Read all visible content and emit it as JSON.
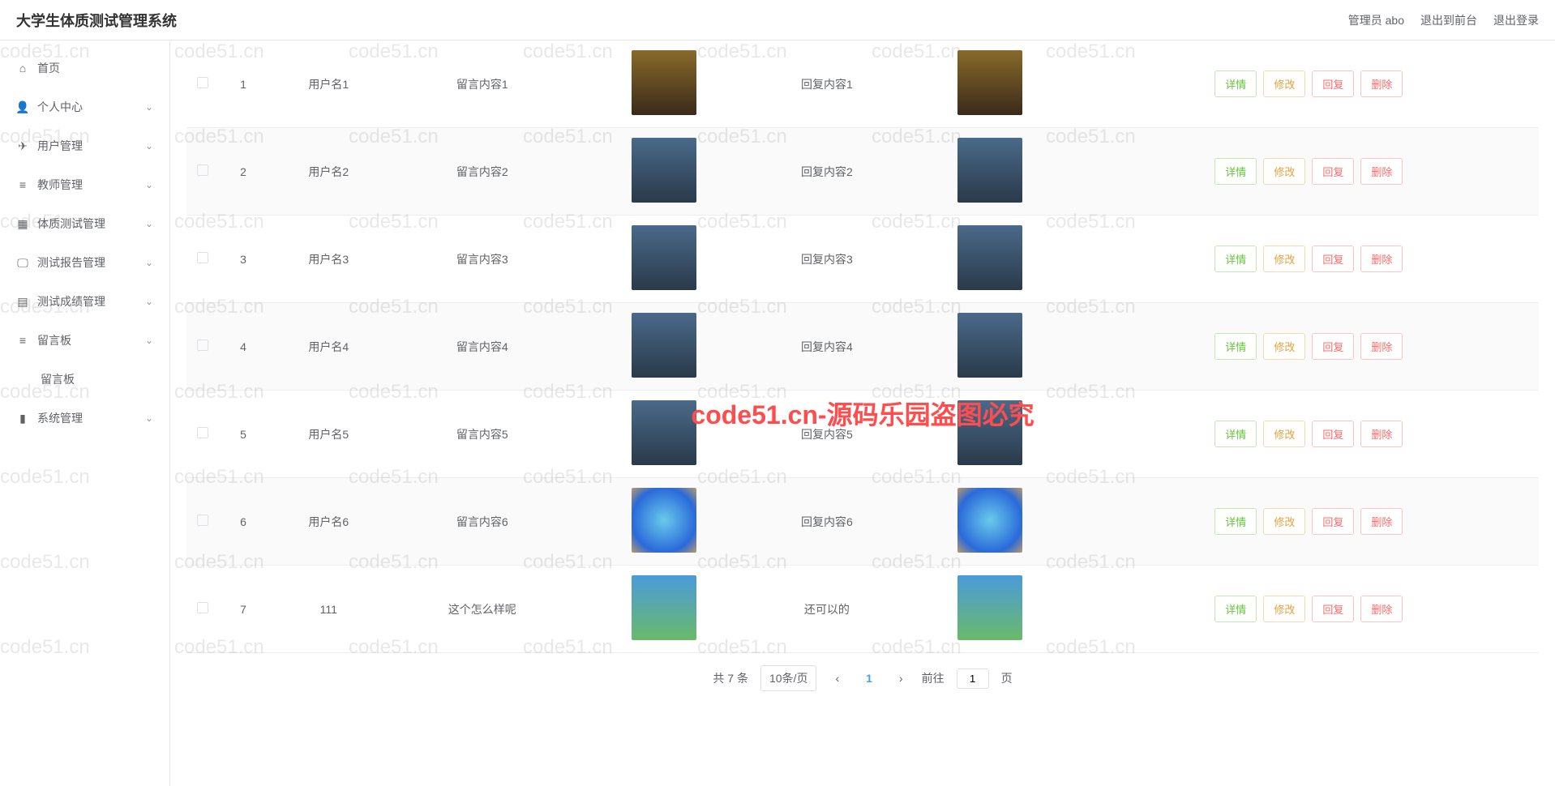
{
  "header": {
    "title": "大学生体质测试管理系统",
    "admin_label": "管理员 abo",
    "exit_front": "退出到前台",
    "logout": "退出登录"
  },
  "sidebar": {
    "items": [
      {
        "icon": "home",
        "label": "首页",
        "expandable": false
      },
      {
        "icon": "user",
        "label": "个人中心",
        "expandable": true
      },
      {
        "icon": "send",
        "label": "用户管理",
        "expandable": true
      },
      {
        "icon": "list",
        "label": "教师管理",
        "expandable": true
      },
      {
        "icon": "grid",
        "label": "体质测试管理",
        "expandable": true
      },
      {
        "icon": "monitor",
        "label": "测试报告管理",
        "expandable": true
      },
      {
        "icon": "file",
        "label": "测试成绩管理",
        "expandable": true
      },
      {
        "icon": "menu",
        "label": "留言板",
        "expandable": true
      },
      {
        "icon": "chart",
        "label": "系统管理",
        "expandable": true
      }
    ],
    "submenu_messageboard": "留言板"
  },
  "table": {
    "rows": [
      {
        "index": "1",
        "username": "用户名1",
        "message": "留言内容1",
        "reply": "回复内容1",
        "thumb": "sunset"
      },
      {
        "index": "2",
        "username": "用户名2",
        "message": "留言内容2",
        "reply": "回复内容2",
        "thumb": "night"
      },
      {
        "index": "3",
        "username": "用户名3",
        "message": "留言内容3",
        "reply": "回复内容3",
        "thumb": "river"
      },
      {
        "index": "4",
        "username": "用户名4",
        "message": "留言内容4",
        "reply": "回复内容4",
        "thumb": "lake"
      },
      {
        "index": "5",
        "username": "用户名5",
        "message": "留言内容5",
        "reply": "回复内容5",
        "thumb": "lake"
      },
      {
        "index": "6",
        "username": "用户名6",
        "message": "留言内容6",
        "reply": "回复内容6",
        "thumb": "blue"
      },
      {
        "index": "7",
        "username": "111",
        "message": "这个怎么样呢",
        "reply": "还可以的",
        "thumb": "sky"
      }
    ],
    "actions": {
      "detail": "详情",
      "edit": "修改",
      "reply": "回复",
      "delete": "删除"
    }
  },
  "pagination": {
    "total": "共 7 条",
    "page_size": "10条/页",
    "current": "1",
    "goto_prefix": "前往",
    "goto_value": "1",
    "goto_suffix": "页"
  },
  "watermark": {
    "main": "code51.cn-源码乐园盗图必究",
    "bg": "code51.cn"
  }
}
